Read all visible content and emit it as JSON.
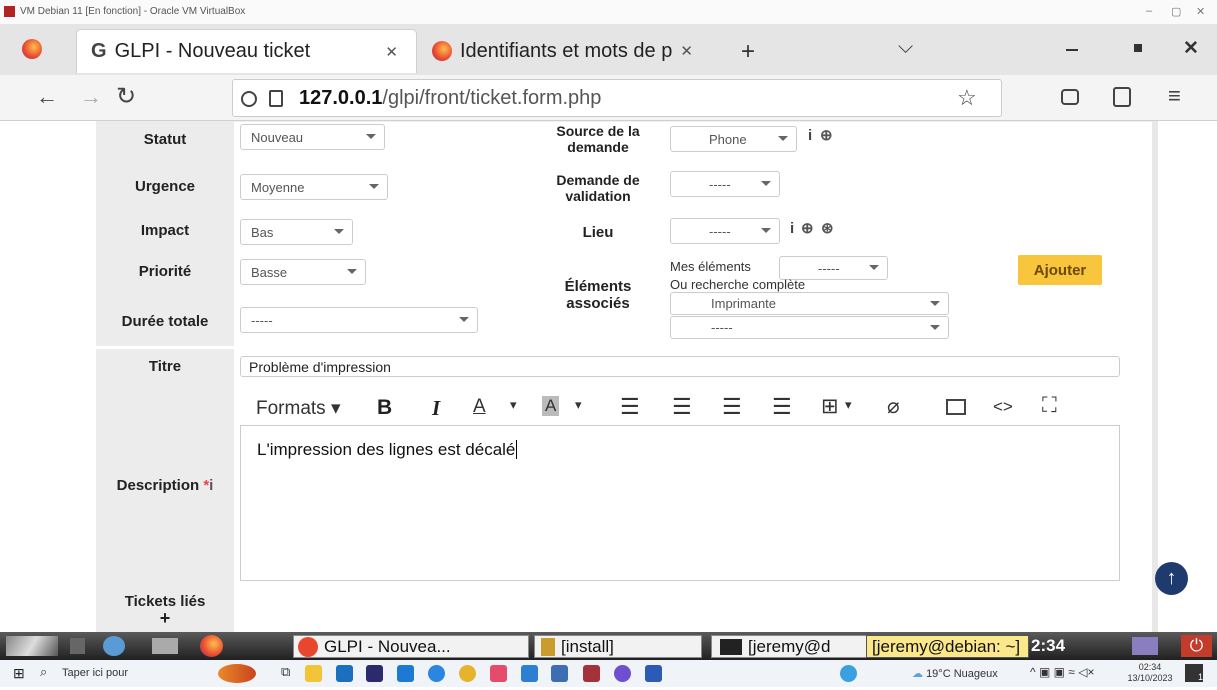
{
  "vm": {
    "title": "VM Debian 11 [En fonction] - Oracle VM VirtualBox",
    "min": "–",
    "max": "▢",
    "close": "✕"
  },
  "browser": {
    "tabs": [
      {
        "label": "GLPI - Nouveau ticket",
        "close": "✕"
      },
      {
        "label": "Identifiants et mots de p",
        "close": "✕"
      }
    ],
    "new_tab": "+",
    "chevron": "⌵",
    "url_host": "127.0.0.1",
    "url_path": "/glpi/front/ticket.form.php"
  },
  "form": {
    "statut": {
      "label": "Statut",
      "value": "Nouveau"
    },
    "urgence": {
      "label": "Urgence",
      "value": "Moyenne"
    },
    "impact": {
      "label": "Impact",
      "value": "Bas"
    },
    "priorite": {
      "label": "Priorité",
      "value": "Basse"
    },
    "duree": {
      "label": "Durée totale",
      "value": "-----"
    },
    "source": {
      "label1": "Source de la",
      "label2": "demande",
      "value": "Phone"
    },
    "validation": {
      "label1": "Demande de",
      "label2": "validation",
      "value": "-----"
    },
    "lieu": {
      "label": "Lieu",
      "value": "-----"
    },
    "elements": {
      "label1": "Éléments",
      "label2": "associés",
      "mes": "Mes éléments",
      "mes_value": "-----",
      "ou": "Ou recherche complète",
      "type_value": "Imprimante",
      "item_value": "-----",
      "ajouter": "Ajouter"
    },
    "titre": {
      "label": "Titre",
      "value": "Problème d'impression"
    },
    "description": {
      "label": "Description",
      "req": "*",
      "info": "i",
      "formats": "Formats",
      "text": "L'impression des lignes est décalé"
    },
    "tickets_lies": {
      "label": "Tickets liés",
      "plus": "+"
    }
  },
  "taskbar1": {
    "items": [
      "GLPI - Nouvea...",
      "[install]",
      "[jeremy@d",
      "[jeremy@debian: ~]"
    ],
    "clock": "2:34"
  },
  "taskbar2": {
    "search": "Taper ici pour",
    "weather": "19°C Nuageux",
    "time": "02:34",
    "date": "13/10/2023",
    "notif": "1"
  },
  "colors": {
    "accent": "#f8c53c",
    "scroll_btn": "#1f3b6e"
  }
}
